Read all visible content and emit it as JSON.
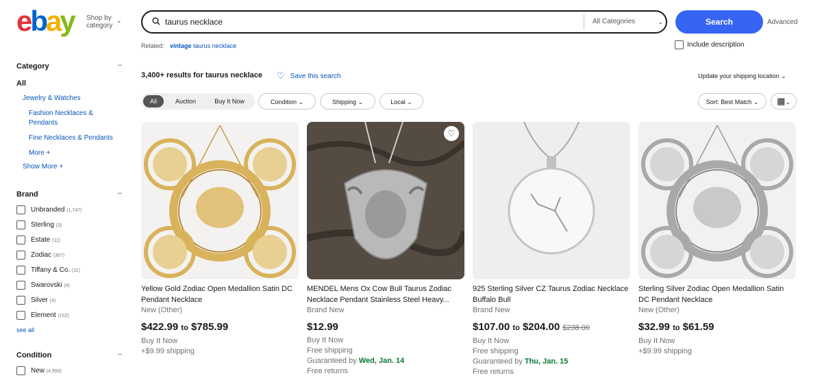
{
  "header": {
    "logo": {
      "e": "e",
      "b": "b",
      "a": "a",
      "y": "y"
    },
    "shop_by_line1": "Shop by",
    "shop_by_line2": "category",
    "search_value": "taurus necklace",
    "category_select": "All Categories",
    "search_button": "Search",
    "advanced": "Advanced",
    "related_label": "Related:",
    "related_bold": "vintage",
    "related_rest": "taurus necklace",
    "include_description": "Include description"
  },
  "sidebar": {
    "category_heading": "Category",
    "all": "All",
    "category_links": [
      "Jewelry & Watches",
      "Fashion Necklaces &",
      "Pendants",
      "Fine Necklaces & Pendants",
      "More +",
      "Show More +"
    ],
    "brand_heading": "Brand",
    "brands": [
      {
        "label": "Unbranded",
        "count": "(1,747)"
      },
      {
        "label": "Sterling",
        "count": "(3)"
      },
      {
        "label": "Estate",
        "count": "(11)"
      },
      {
        "label": "Zodiac",
        "count": "(367)"
      },
      {
        "label": "Tiffany & Co.",
        "count": "(11)"
      },
      {
        "label": "Swarovski",
        "count": "(4)"
      },
      {
        "label": "Silver",
        "count": "(4)"
      },
      {
        "label": "Element",
        "count": "(152)"
      }
    ],
    "see_all": "see all",
    "condition_heading": "Condition",
    "conditions": [
      {
        "label": "New",
        "count": "(4,993)"
      }
    ]
  },
  "results": {
    "count_prefix": "3,400+ results for",
    "query": "taurus necklace",
    "save_search": "Save this search",
    "shipping_location": "Update your shipping location",
    "filters": [
      "All",
      "Auction",
      "Buy It Now",
      "Condition",
      "Shipping",
      "Local"
    ],
    "sort": "Sort: Best Match"
  },
  "listings": [
    {
      "title": "Yellow Gold Zodiac Open Medallion Satin DC Pendant Necklace",
      "condition": "New (Other)",
      "price_low": "$422.99",
      "price_to": "to",
      "price_high": "$785.99",
      "strike": "",
      "line1": "Buy It Now",
      "line2": "+$9.99 shipping",
      "guarantee_prefix": "",
      "guarantee_date": "",
      "line4": ""
    },
    {
      "title": "MENDEL Mens Ox Cow Bull Taurus Zodiac Necklace Pendant Stainless Steel Heavy...",
      "condition": "Brand New",
      "price_low": "$12.99",
      "price_to": "",
      "price_high": "",
      "strike": "",
      "line1": "Buy It Now",
      "line2": "Free shipping",
      "guarantee_prefix": "Guaranteed by",
      "guarantee_date": "Wed, Jan. 14",
      "line4": "Free returns"
    },
    {
      "title": "925 Sterling Silver CZ Taurus Zodiac Necklace Buffalo Bull",
      "condition": "Brand New",
      "price_low": "$107.00",
      "price_to": "to",
      "price_high": "$204.00",
      "strike": "$238.00",
      "line1": "Buy It Now",
      "line2": "Free shipping",
      "guarantee_prefix": "Guaranteed by",
      "guarantee_date": "Thu, Jan. 15",
      "line4": "Free returns"
    },
    {
      "title": "Sterling Silver Zodiac Open Medallion Satin DC Pendant Necklace",
      "condition": "New (Other)",
      "price_low": "$32.99",
      "price_to": "to",
      "price_high": "$61.59",
      "strike": "",
      "line1": "Buy It Now",
      "line2": "+$9.99 shipping",
      "guarantee_prefix": "",
      "guarantee_date": "",
      "line4": ""
    }
  ],
  "colors": {
    "primary_blue": "#3665f3",
    "link_blue": "#0654ba",
    "green": "#057a2e",
    "gold": "#d9b25c",
    "silver": "#b9b9b9"
  }
}
